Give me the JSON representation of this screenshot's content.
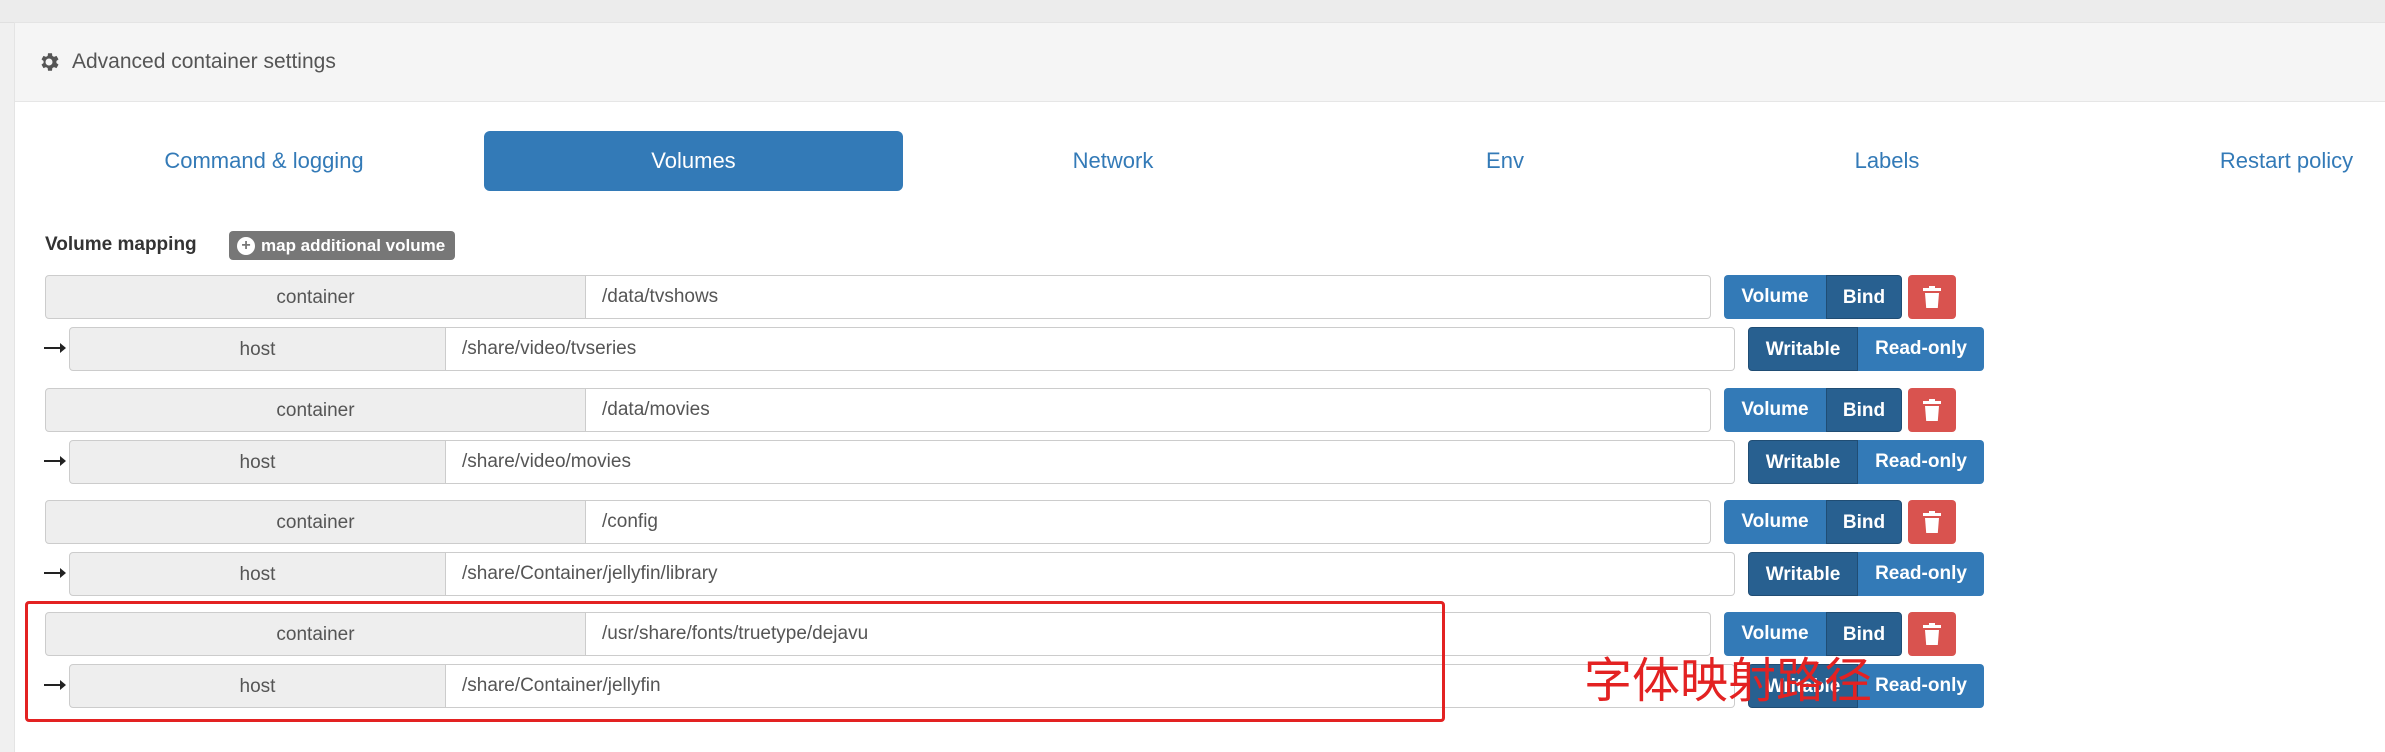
{
  "panel": {
    "title": "Advanced container settings"
  },
  "tabs": [
    {
      "label": "Command & logging",
      "active": false
    },
    {
      "label": "Volumes",
      "active": true
    },
    {
      "label": "Network",
      "active": false
    },
    {
      "label": "Env",
      "active": false
    },
    {
      "label": "Labels",
      "active": false
    },
    {
      "label": "Restart policy",
      "active": false
    }
  ],
  "volumes": {
    "section_label": "Volume mapping",
    "add_button": "map additional volume",
    "container_label": "container",
    "host_label": "host",
    "type_volume": "Volume",
    "type_bind": "Bind",
    "mode_writable": "Writable",
    "mode_readonly": "Read-only",
    "mappings": [
      {
        "container": "/data/tvshows",
        "host": "/share/video/tvseries",
        "type": "Bind",
        "mode": "Writable"
      },
      {
        "container": "/data/movies",
        "host": "/share/video/movies",
        "type": "Bind",
        "mode": "Writable"
      },
      {
        "container": "/config",
        "host": "/share/Container/jellyfin/library",
        "type": "Bind",
        "mode": "Writable"
      },
      {
        "container": "/usr/share/fonts/truetype/dejavu",
        "host": "/share/Container/jellyfin",
        "type": "Bind",
        "mode": "Writable"
      }
    ]
  },
  "annotation": {
    "text": "字体映射路径",
    "color": "#e32222"
  },
  "colors": {
    "primary": "#337ab7",
    "primary_active": "#286090",
    "danger": "#d9534f",
    "muted": "#777777"
  }
}
